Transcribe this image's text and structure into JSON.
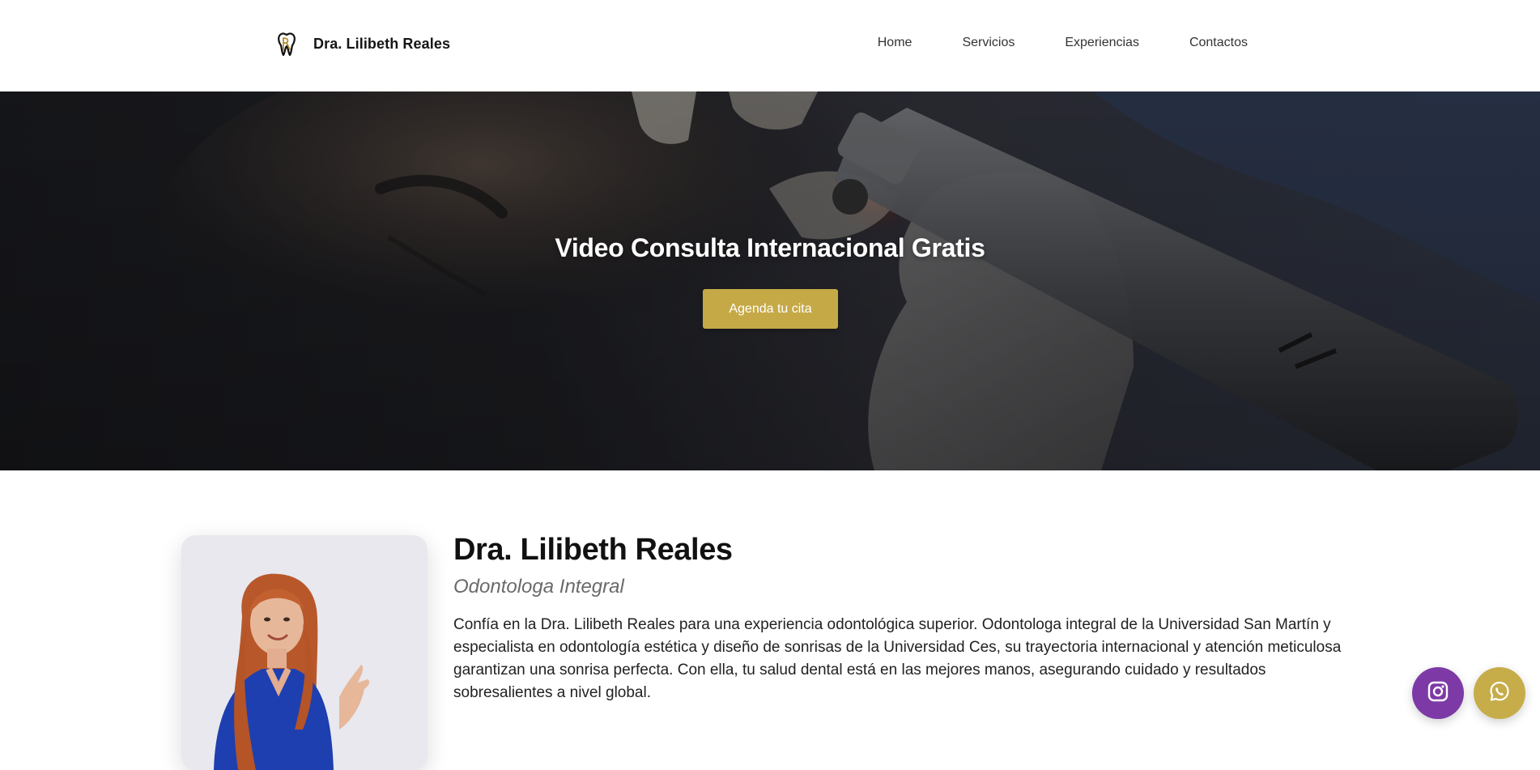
{
  "header": {
    "brand_name": "Dra. Lilibeth Reales",
    "logo_icon": "tooth-icon",
    "nav": [
      {
        "label": "Home"
      },
      {
        "label": "Servicios"
      },
      {
        "label": "Experiencias"
      },
      {
        "label": "Contactos"
      }
    ]
  },
  "hero": {
    "title": "Video Consulta Internacional Gratis",
    "cta_label": "Agenda tu cita",
    "background_image": "dental-procedure-photo"
  },
  "about": {
    "name": "Dra. Lilibeth Reales",
    "role": "Odontologa Integral",
    "description": "Confía en la Dra. Lilibeth Reales para una experiencia odontológica superior. Odontologa integral de la Universidad San Martín y especialista en odontología estética y diseño de sonrisas de la Universidad Ces, su trayectoria internacional y atención meticulosa garantizan una sonrisa perfecta. Con ella, tu salud dental está en las mejores manos, asegurando cuidado y resultados sobresalientes a nivel global.",
    "photo": "doctor-portrait-photo"
  },
  "floating": {
    "instagram_icon": "instagram-icon",
    "whatsapp_icon": "whatsapp-icon"
  },
  "colors": {
    "accent_gold": "#c6a947",
    "instagram_purple": "#7d3aa6",
    "whatsapp_gold": "#c6ad4a"
  }
}
